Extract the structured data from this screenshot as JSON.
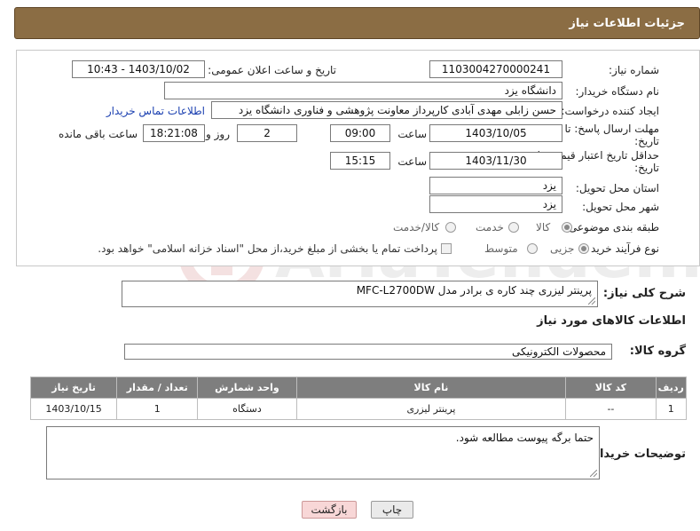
{
  "header": {
    "title": "جزئیات اطلاعات نیاز"
  },
  "fields": {
    "need_number_label": "شماره نیاز:",
    "need_number": "1103004270000241",
    "announce_label": "تاریخ و ساعت اعلان عمومی:",
    "announce_value": "1403/10/02 - 10:43",
    "buyer_org_label": "نام دستگاه خریدار:",
    "buyer_org": "دانشگاه یزد",
    "requester_label": "ایجاد کننده درخواست:",
    "requester": "حسن زابلی مهدی آبادی کارپرداز معاونت پژوهشی و فناوری دانشگاه یزد",
    "contact_link": "اطلاعات تماس خریدار",
    "reply_deadline_label_1": "مهلت ارسال پاسخ: تا",
    "reply_deadline_label_2": "تاریخ:",
    "reply_date": "1403/10/05",
    "time_label": "ساعت",
    "reply_time": "09:00",
    "days_value": "2",
    "days_label": "روز و",
    "remaining_time": "18:21:08",
    "remaining_label": "ساعت باقی مانده",
    "price_deadline_label_1": "حداقل تاریخ اعتبار قیمت: تا",
    "price_deadline_label_2": "تاریخ:",
    "price_date": "1403/11/30",
    "price_time_label": "ساعت",
    "price_time": "15:15",
    "province_label": "استان محل تحویل:",
    "province": "یزد",
    "city_label": "شهر محل تحویل:",
    "city": "یزد",
    "category_label": "طبقه بندی موضوعی:",
    "category_options": [
      "کالا",
      "خدمت",
      "کالا/خدمت"
    ],
    "category_selected": "کالا",
    "process_label": "نوع فرآیند خرید :",
    "process_options": [
      "جزیی",
      "متوسط"
    ],
    "process_selected": "جزیی",
    "payment_note": "پرداخت تمام یا بخشی از مبلغ خرید،از محل \"اسناد خزانه اسلامی\" خواهد بود."
  },
  "description": {
    "label": "شرح کلی نیاز:",
    "value": "پرینتر لیزری چند کاره ی برادر مدل MFC-L2700DW"
  },
  "goods_section_title": "اطلاعات کالاهای مورد نیاز",
  "goods_group": {
    "label": "گروه کالا:",
    "value": "محصولات الکترونیکی"
  },
  "goods_table": {
    "headers": [
      "ردیف",
      "کد کالا",
      "نام کالا",
      "واحد شمارش",
      "تعداد / مقدار",
      "تاریخ نیاز"
    ],
    "rows": [
      [
        "1",
        "--",
        "پرینتر لیزری",
        "دستگاه",
        "1",
        "1403/10/15"
      ]
    ]
  },
  "buyer_notes": {
    "label": "توضیحات خریدار:",
    "value": "حتما برگه پیوست مطالعه شود."
  },
  "buttons": {
    "print": "چاپ",
    "back": "بازگشت"
  },
  "watermark": {
    "brand": "AriaTender.net"
  },
  "colors": {
    "header_bg": "#8b6d44",
    "table_header_bg": "#7e7e7e",
    "link": "#1a3fb0",
    "back_button_bg": "#f8d7d7"
  }
}
